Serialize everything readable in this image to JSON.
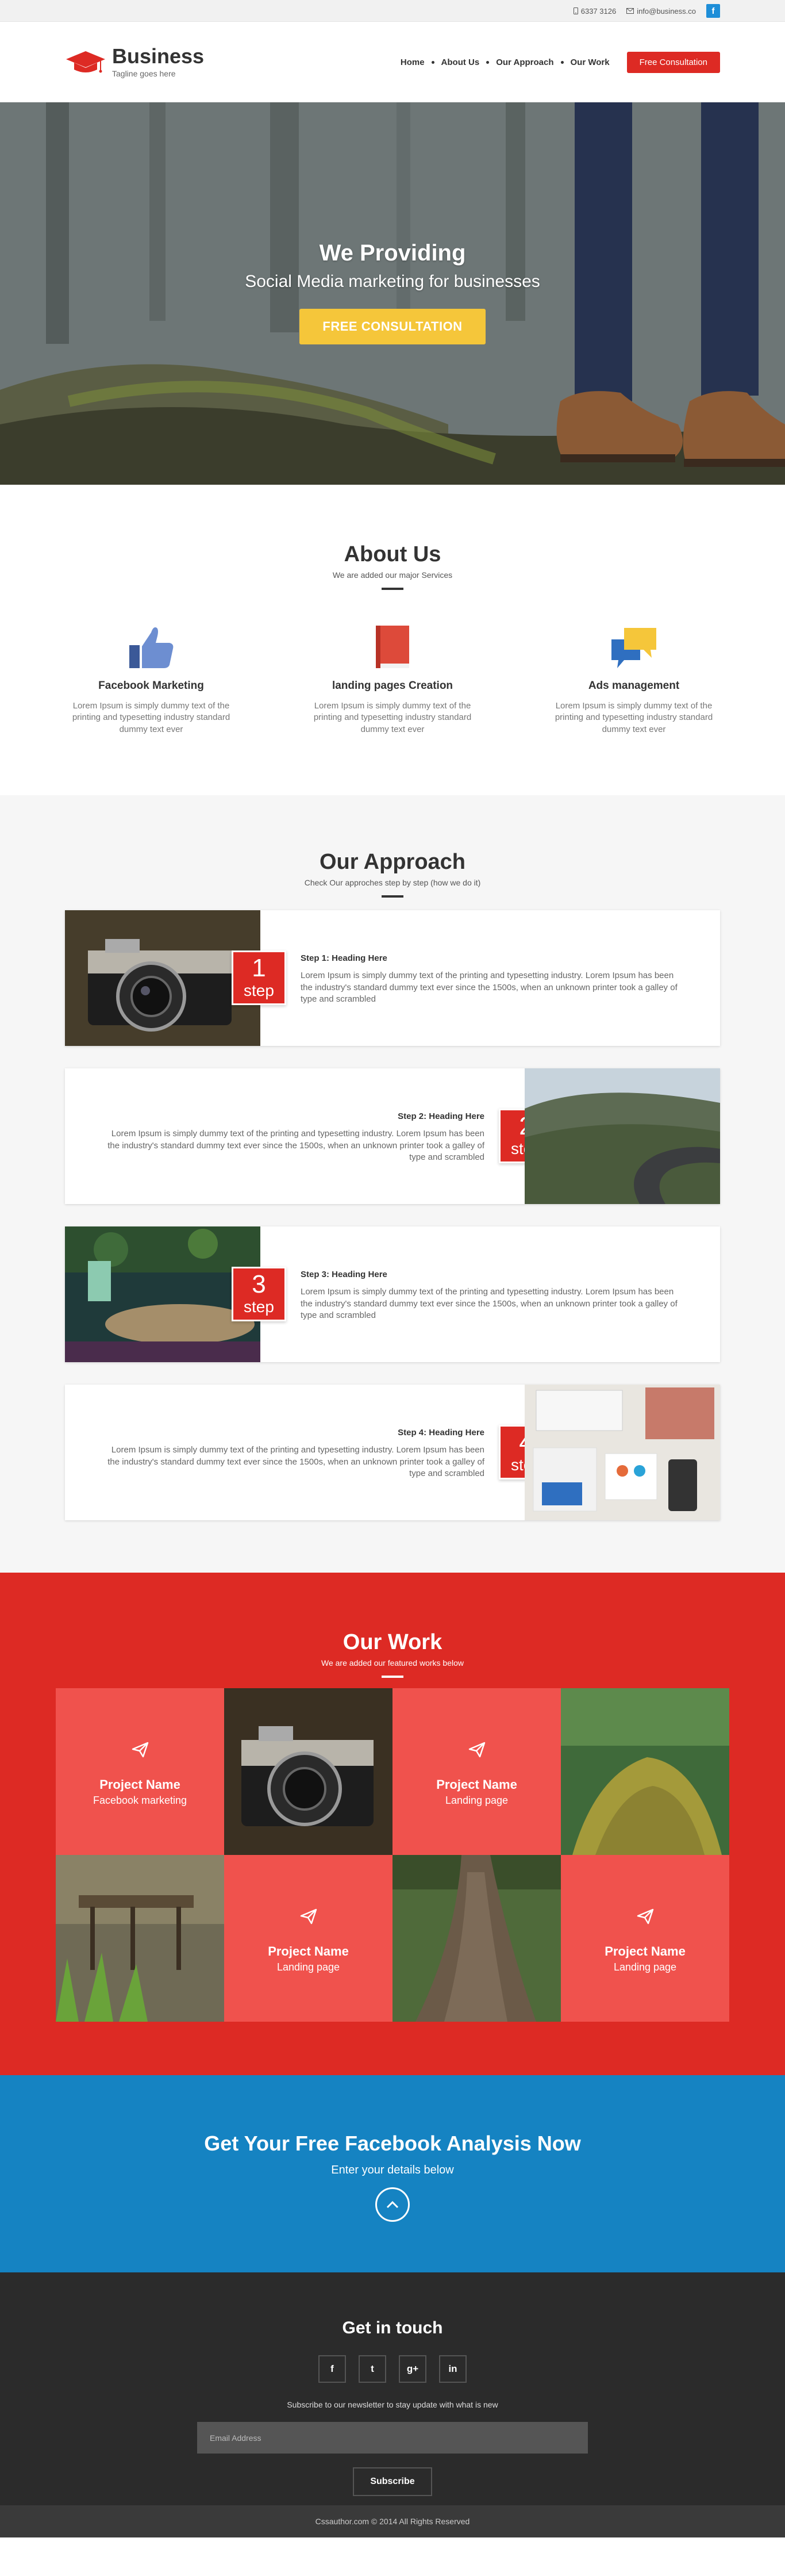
{
  "topbar": {
    "phone": "6337 3126",
    "email": "info@business.co",
    "facebook": "f"
  },
  "brand": {
    "name": "Business",
    "tagline": "Tagline goes here"
  },
  "nav": {
    "items": [
      "Home",
      "About Us",
      "Our Approach",
      "Our Work"
    ],
    "cta": "Free Consultation"
  },
  "hero": {
    "title": "We Providing",
    "subtitle": "Social Media marketing for businesses",
    "button": "FREE CONSULTATION"
  },
  "about": {
    "title": "About Us",
    "subtitle": "We are added our major Services",
    "items": [
      {
        "icon": "thumbs-up-icon",
        "title": "Facebook Marketing",
        "text": "Lorem Ipsum is simply dummy text of the printing and typesetting industry standard dummy text ever"
      },
      {
        "icon": "book-icon",
        "title": "landing pages Creation",
        "text": "Lorem Ipsum is simply dummy text of the printing and typesetting industry standard dummy text ever"
      },
      {
        "icon": "chat-bubbles-icon",
        "title": "Ads management",
        "text": "Lorem Ipsum is simply dummy text of the printing and typesetting industry standard dummy text ever"
      }
    ]
  },
  "approach": {
    "title": "Our Approach",
    "subtitle": "Check Our approches step by step (how we do it)",
    "step_word": "step",
    "steps": [
      {
        "num": "1",
        "heading": "Step 1: Heading Here",
        "text": "Lorem Ipsum is simply dummy text of the printing and typesetting industry. Lorem Ipsum has been the industry's standard dummy text ever since the 1500s, when an unknown printer took a galley of type and scrambled"
      },
      {
        "num": "2",
        "heading": "Step 2: Heading Here",
        "text": "Lorem Ipsum is simply dummy text of the printing and typesetting industry. Lorem Ipsum has been the industry's standard dummy text ever since the 1500s, when an unknown printer took a galley of type and scrambled"
      },
      {
        "num": "3",
        "heading": "Step 3: Heading Here",
        "text": "Lorem Ipsum is simply dummy text of the printing and typesetting industry. Lorem Ipsum has been the industry's standard dummy text ever since the 1500s, when an unknown printer took a galley of type and scrambled"
      },
      {
        "num": "4",
        "heading": "Step 4: Heading Here",
        "text": "Lorem Ipsum is simply dummy text of the printing and typesetting industry. Lorem Ipsum has been the industry's standard dummy text ever since the 1500s, when an unknown printer took a galley of type and scrambled"
      }
    ]
  },
  "work": {
    "title": "Our Work",
    "subtitle": "We are added our featured works below",
    "projects": [
      {
        "name": "Project Name",
        "sub": "Facebook marketing"
      },
      {
        "name": "Project Name",
        "sub": "Landing page"
      },
      {
        "name": "Project Name",
        "sub": "Landing page"
      },
      {
        "name": "Project Name",
        "sub": "Landing page"
      }
    ]
  },
  "cta": {
    "title": "Get Your Free Facebook Analysis Now",
    "subtitle": "Enter your details below"
  },
  "footer": {
    "title": "Get in touch",
    "socials": [
      "f",
      "t",
      "g+",
      "in"
    ],
    "newsletter_text": "Subscribe to our newsletter to stay update with what is new",
    "email_placeholder": "Email Address",
    "subscribe": "Subscribe",
    "copyright": "Cssauthor.com © 2014 All Rights Reserved"
  },
  "colors": {
    "red": "#dd2a24",
    "tile": "#f0524d",
    "yellow": "#f5c63a",
    "blue": "#1583c2",
    "dark": "#2b2b2b"
  }
}
